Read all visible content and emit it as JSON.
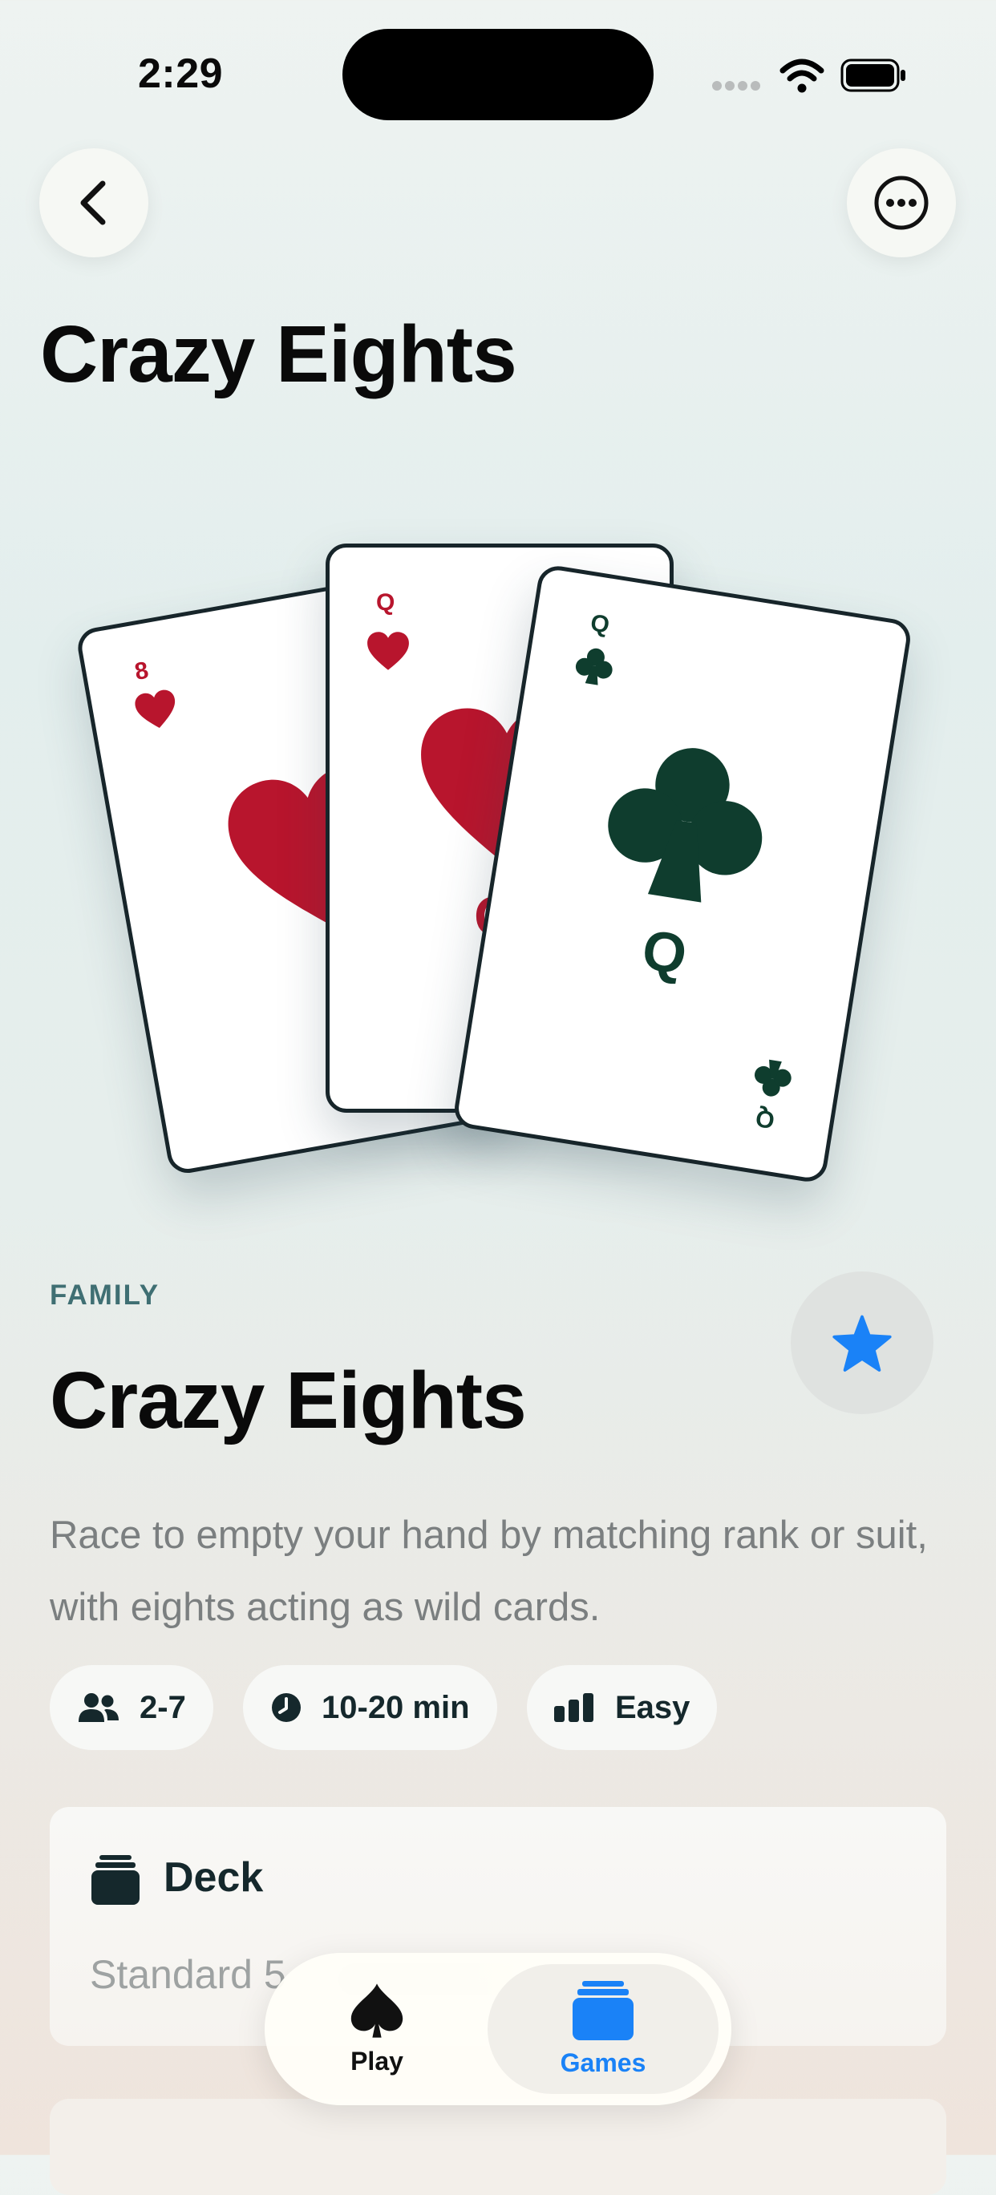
{
  "status_bar": {
    "time": "2:29"
  },
  "header": {
    "title": "Crazy Eights"
  },
  "cards_art": {
    "left_card": {
      "rank": "8",
      "suit": "hearts",
      "color": "#b8152d"
    },
    "middle_card": {
      "rank": "Q",
      "suit": "hearts",
      "color": "#b8152d"
    },
    "right_card": {
      "rank": "Q",
      "suit": "clubs",
      "color": "#0f3d2e"
    }
  },
  "game": {
    "category": "FAMILY",
    "title": "Crazy Eights",
    "description": "Race to empty your hand by matching rank or suit, with eights acting as wild cards.",
    "favorite_color": "#1a82f7"
  },
  "chips": [
    {
      "icon": "people-icon",
      "label": "2-7"
    },
    {
      "icon": "clock-icon",
      "label": "10-20 min"
    },
    {
      "icon": "difficulty-bars-icon",
      "label": "Easy"
    }
  ],
  "deck": {
    "title": "Deck",
    "subtitle": "Standard 5"
  },
  "tabbar": {
    "tabs": [
      {
        "label": "Play",
        "icon": "spade-icon",
        "selected": false
      },
      {
        "label": "Games",
        "icon": "cards-stack-icon",
        "selected": true
      }
    ],
    "accent": "#1a82f7"
  }
}
